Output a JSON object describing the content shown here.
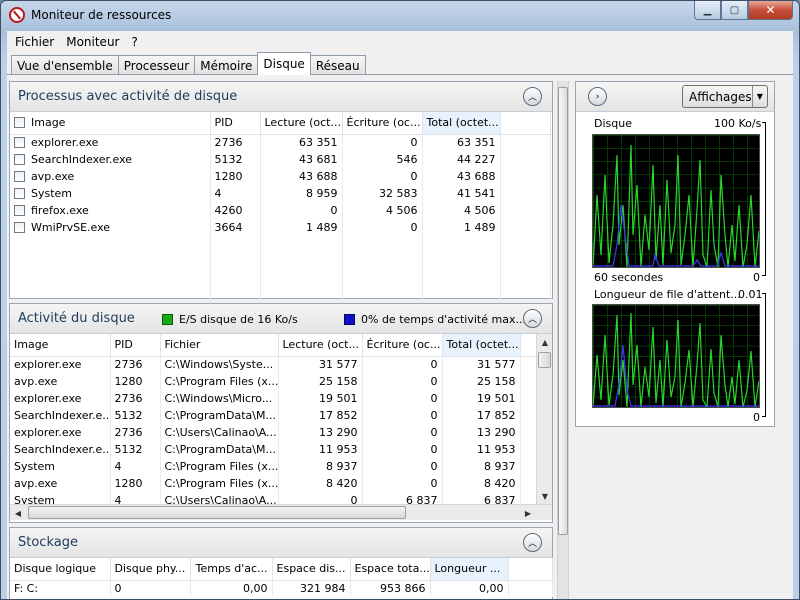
{
  "window": {
    "title": "Moniteur de ressources"
  },
  "menu": [
    "Fichier",
    "Moniteur",
    "?"
  ],
  "tabs": [
    {
      "label": "Vue d'ensemble",
      "active": false
    },
    {
      "label": "Processeur",
      "active": false
    },
    {
      "label": "Mémoire",
      "active": false
    },
    {
      "label": "Disque",
      "active": true
    },
    {
      "label": "Réseau",
      "active": false
    }
  ],
  "processes": {
    "title": "Processus avec activité de disque",
    "columns": [
      "Image",
      "PID",
      "Lecture (oct...",
      "Écriture (oc...",
      "Total (octet..."
    ],
    "rows": [
      [
        "explorer.exe",
        "2736",
        "63 351",
        "0",
        "63 351"
      ],
      [
        "SearchIndexer.exe",
        "5132",
        "43 681",
        "546",
        "44 227"
      ],
      [
        "avp.exe",
        "1280",
        "43 688",
        "0",
        "43 688"
      ],
      [
        "System",
        "4",
        "8 959",
        "32 583",
        "41 541"
      ],
      [
        "firefox.exe",
        "4260",
        "0",
        "4 506",
        "4 506"
      ],
      [
        "WmiPrvSE.exe",
        "3664",
        "1 489",
        "0",
        "1 489"
      ]
    ]
  },
  "disk_activity": {
    "title": "Activité du disque",
    "legend_io": "E/S disque de 16 Ko/s",
    "legend_active": "0% de temps d'activité max...",
    "color_io": "#17a817",
    "color_active": "#1010c8",
    "columns": [
      "Image",
      "PID",
      "Fichier",
      "Lecture (oct...",
      "Écriture (oc...",
      "Total (octet..."
    ],
    "rows": [
      [
        "explorer.exe",
        "2736",
        "C:\\Windows\\Syste...",
        "31 577",
        "0",
        "31 577"
      ],
      [
        "avp.exe",
        "1280",
        "C:\\Program Files (x...",
        "25 158",
        "0",
        "25 158"
      ],
      [
        "explorer.exe",
        "2736",
        "C:\\Windows\\Micro...",
        "19 501",
        "0",
        "19 501"
      ],
      [
        "SearchIndexer.e...",
        "5132",
        "C:\\ProgramData\\M...",
        "17 852",
        "0",
        "17 852"
      ],
      [
        "explorer.exe",
        "2736",
        "C:\\Users\\Calinao\\A...",
        "13 290",
        "0",
        "13 290"
      ],
      [
        "SearchIndexer.e...",
        "5132",
        "C:\\ProgramData\\M...",
        "11 953",
        "0",
        "11 953"
      ],
      [
        "System",
        "4",
        "C:\\Program Files (x...",
        "8 937",
        "0",
        "8 937"
      ],
      [
        "avp.exe",
        "1280",
        "C:\\Program Files (x...",
        "8 420",
        "0",
        "8 420"
      ],
      [
        "System",
        "4",
        "C:\\Users\\Calinao\\A...",
        "0",
        "6 837",
        "6 837"
      ]
    ]
  },
  "storage": {
    "title": "Stockage",
    "columns": [
      "Disque logique",
      "Disque phy...",
      "Temps d'ac...",
      "Espace dis...",
      "Espace tota...",
      "Longueur ..."
    ],
    "rows": [
      [
        "F: C:",
        "0",
        "0,00",
        "321 984",
        "953 866",
        "0,00"
      ]
    ]
  },
  "right_panel": {
    "views_label": "Affichages",
    "graph1": {
      "label": "Disque",
      "max": "100 Ko/s",
      "bottom_left": "60 secondes",
      "bottom_right": "0"
    },
    "graph2": {
      "label": "Longueur de file d'attent...",
      "max": "0.01",
      "bottom_right": "0"
    }
  }
}
